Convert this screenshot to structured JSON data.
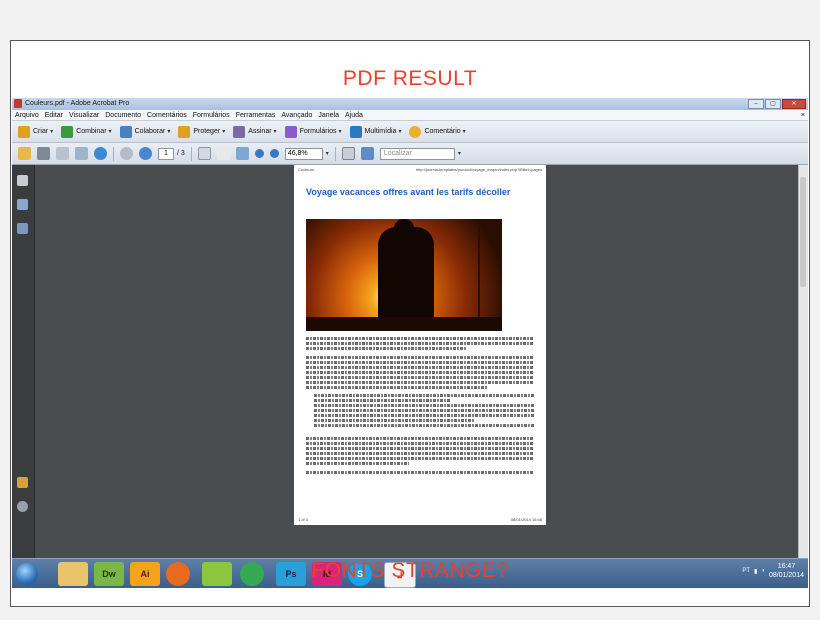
{
  "captions": {
    "top": "PDF RESULT",
    "bottom": "FONTS  STRANGE?"
  },
  "window": {
    "title": "Couleurs.pdf - Adobe Acrobat Pro",
    "controls": [
      "–",
      "▢",
      "✕"
    ]
  },
  "menubar": {
    "items": [
      "Arquivo",
      "Editar",
      "Visualizar",
      "Documento",
      "Comentários",
      "Formulários",
      "Ferramentas",
      "Avançado",
      "Janela",
      "Ajuda"
    ],
    "close": "×"
  },
  "toolbar": {
    "buttons": [
      {
        "label": "Criar",
        "icon": "create-pdf-icon",
        "color": "#e0a020"
      },
      {
        "label": "Combinar",
        "icon": "combine-icon",
        "color": "#3a9a3a"
      },
      {
        "label": "Colaborar",
        "icon": "collaborate-icon",
        "color": "#4a7fc0"
      },
      {
        "label": "Proteger",
        "icon": "lock-icon",
        "color": "#e0a020"
      },
      {
        "label": "Assinar",
        "icon": "pen-icon",
        "color": "#7a6aa0"
      },
      {
        "label": "Formulários",
        "icon": "form-icon",
        "color": "#8a5ad0"
      },
      {
        "label": "Multimídia",
        "icon": "multimedia-icon",
        "color": "#2a7ac0"
      },
      {
        "label": "Comentário",
        "icon": "comment-icon",
        "color": "#e8b030"
      }
    ]
  },
  "nav": {
    "page_current": "1",
    "page_total": "/ 3",
    "zoom": "46,8%",
    "search_placeholder": "Localizar"
  },
  "document": {
    "header_left": "Couleurs",
    "header_right": "http://joomla-templates/product/voyage_mapro/index.php?lBillet=pages",
    "title": "Voyage vacances offres avant les tarifs décoller",
    "footer_left": "1 of 3",
    "footer_right": "08/01/2014 16:48"
  },
  "taskbar": {
    "apps": [
      {
        "label": "",
        "icon": "folder-icon",
        "color": "#e8c46a"
      },
      {
        "label": "Dw",
        "icon": "dreamweaver-icon",
        "color": "#7ab648"
      },
      {
        "label": "Ai",
        "icon": "illustrator-icon",
        "color": "#f7a21b"
      },
      {
        "label": "",
        "icon": "firefox-icon",
        "color": "#e66a1f"
      },
      {
        "label": "",
        "icon": "notepad-icon",
        "color": "#8cc63e"
      },
      {
        "label": "",
        "icon": "chrome-icon",
        "color": "#34a853"
      },
      {
        "label": "Ps",
        "icon": "photoshop-icon",
        "color": "#2a9fd8"
      },
      {
        "label": "Id",
        "icon": "indesign-icon",
        "color": "#d6257a"
      },
      {
        "label": "S",
        "icon": "skype-icon",
        "color": "#1aa3e8"
      },
      {
        "label": "",
        "icon": "acrobat-icon",
        "color": "#e03b2e"
      }
    ],
    "tray_lang": "PT",
    "time": "16:47",
    "date": "08/01/2014"
  }
}
